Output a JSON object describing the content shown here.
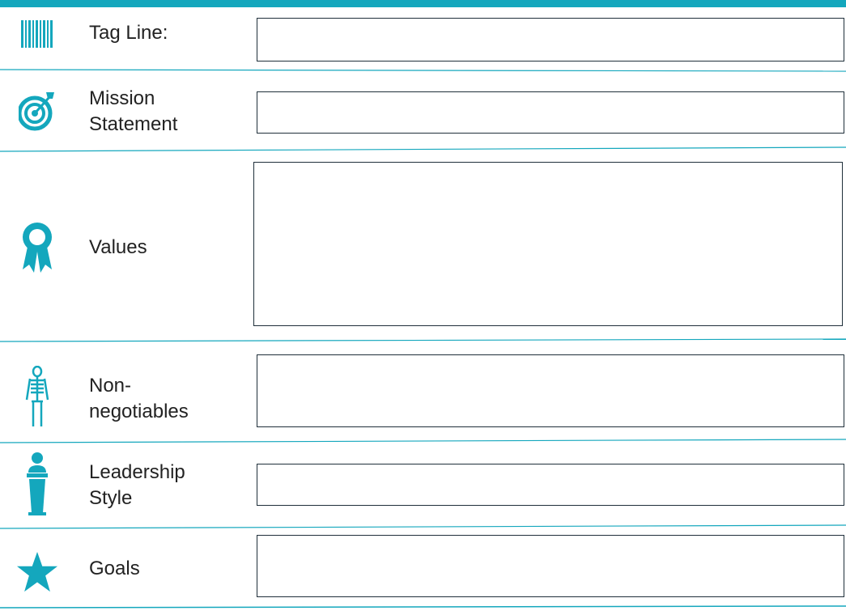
{
  "colors": {
    "accent": "#14a7bd",
    "box_border": "#1f2f3a"
  },
  "rows": [
    {
      "label": "Tag Line:",
      "icon": "barcode-icon"
    },
    {
      "label": "Mission\nStatement",
      "icon": "target-icon"
    },
    {
      "label": "Values",
      "icon": "award-ribbon-icon"
    },
    {
      "label": "Non-\nnegotiables",
      "icon": "skeleton-icon"
    },
    {
      "label": "Leadership\nStyle",
      "icon": "podium-speaker-icon"
    },
    {
      "label": "Goals",
      "icon": "star-icon"
    }
  ]
}
